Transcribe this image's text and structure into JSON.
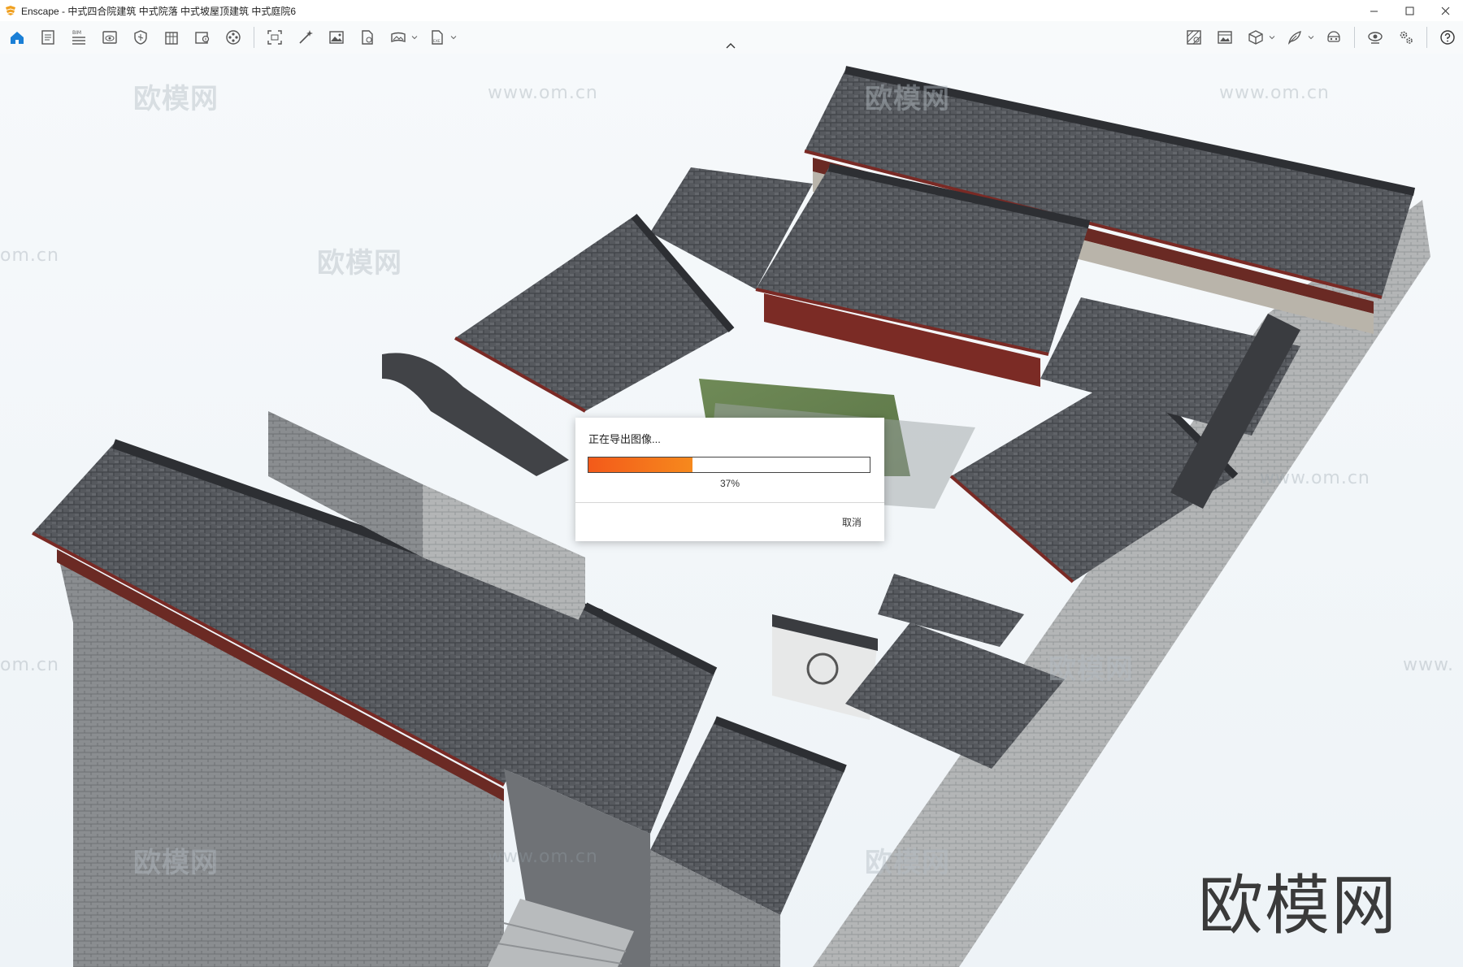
{
  "window": {
    "title": "Enscape - 中式四合院建筑 中式院落 中式坡屋顶建筑 中式庭院6"
  },
  "toolbar": {
    "left": [
      {
        "icon": "home-icon"
      },
      {
        "icon": "document-icon"
      },
      {
        "icon": "bim-icon",
        "badge": "BIM"
      },
      {
        "icon": "eye-frame-icon"
      },
      {
        "icon": "shield-map-icon"
      },
      {
        "icon": "building-icon"
      },
      {
        "icon": "book-icon"
      },
      {
        "icon": "film-reel-icon"
      },
      {
        "icon": "screenshot-icon"
      },
      {
        "icon": "magic-wand-icon"
      },
      {
        "icon": "image-icon"
      },
      {
        "icon": "file-refresh-icon"
      },
      {
        "icon": "panorama-icon"
      },
      {
        "icon": "export-file-icon",
        "badge": "EXE"
      }
    ],
    "right": [
      {
        "icon": "material-icon"
      },
      {
        "icon": "image-gallery-icon"
      },
      {
        "icon": "cube-icon"
      },
      {
        "icon": "feather-icon"
      },
      {
        "icon": "vr-headset-icon"
      },
      {
        "icon": "visual-settings-icon"
      },
      {
        "icon": "gear-icon"
      },
      {
        "icon": "help-icon"
      }
    ]
  },
  "watermarks": {
    "brand_cn": "欧模网",
    "url": "www.om.cn",
    "url_partial": "om.cn",
    "url_partial_right": "www."
  },
  "dialog": {
    "title": "正在导出图像...",
    "progress_percent": 37,
    "progress_label": "37%",
    "cancel_label": "取消"
  },
  "colors": {
    "accent": "#1a7fd6",
    "progress_start": "#f35a1a",
    "progress_end": "#f6891d",
    "logo": "#f0a020"
  }
}
